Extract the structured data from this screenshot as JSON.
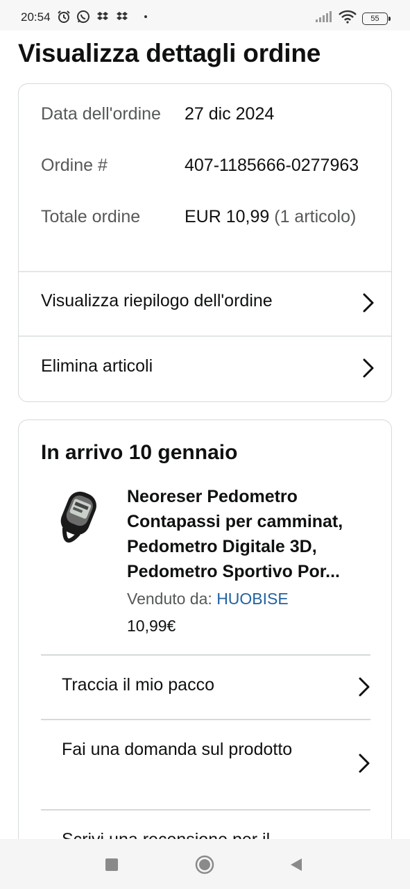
{
  "status_bar": {
    "time": "20:54",
    "battery": "55"
  },
  "page": {
    "title": "Visualizza dettagli ordine"
  },
  "order_details": {
    "date_label": "Data dell'ordine",
    "date_value": "27 dic 2024",
    "number_label": "Ordine #",
    "number_value": "407-1185666-0277963",
    "total_label": "Totale ordine",
    "total_value": "EUR 10,99",
    "total_items": "(1 articolo)",
    "summary_link": "Visualizza riepilogo dell'ordine",
    "delete_link": "Elimina articoli"
  },
  "shipment": {
    "arrival": "In arrivo 10 gennaio",
    "product_title": "Neoreser Pedometro Contapassi per camminat, Pedometro Digitale 3D, Pedometro Sportivo Por...",
    "seller_label": "Venduto da:",
    "seller_name": "HUOBISE",
    "price": "10,99€",
    "actions": [
      {
        "label": "Traccia il mio pacco"
      },
      {
        "label": "Fai una domanda sul prodotto"
      },
      {
        "label": "Scrivi una recensione per il"
      }
    ]
  },
  "icons": {
    "chevron": "chevron-right-icon",
    "alarm": "alarm-icon",
    "whatsapp": "whatsapp-icon",
    "dropbox": "dropbox-icon",
    "signal": "signal-icon",
    "wifi": "wifi-icon",
    "battery": "battery-icon"
  }
}
